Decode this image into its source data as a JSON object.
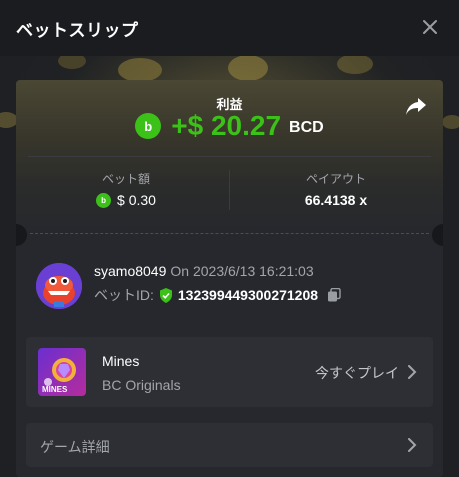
{
  "header": {
    "title": "ベットスリップ"
  },
  "profit": {
    "label": "利益",
    "amount": "+$ 20.27",
    "currency": "BCD"
  },
  "stats": {
    "bet_label": "ベット額",
    "bet_value": "$ 0.30",
    "payout_label": "ペイアウト",
    "payout_value": "66.4138 x"
  },
  "user": {
    "name": "syamo8049",
    "timestamp": "On 2023/6/13 16:21:03",
    "bet_id_label": "ベットID:",
    "bet_id": "132399449300271208"
  },
  "game": {
    "name": "Mines",
    "provider": "BC Originals",
    "thumb_label": "MINES",
    "play_label": "今すぐプレイ"
  },
  "details": {
    "label": "ゲーム詳細"
  },
  "colors": {
    "profit_green": "#3bc117",
    "panel": "#26282d",
    "card": "#2d2f34"
  },
  "icons": [
    "close-icon",
    "share-icon",
    "bcd-coin-icon",
    "verified-shield-icon",
    "copy-icon",
    "chevron-right-icon"
  ]
}
